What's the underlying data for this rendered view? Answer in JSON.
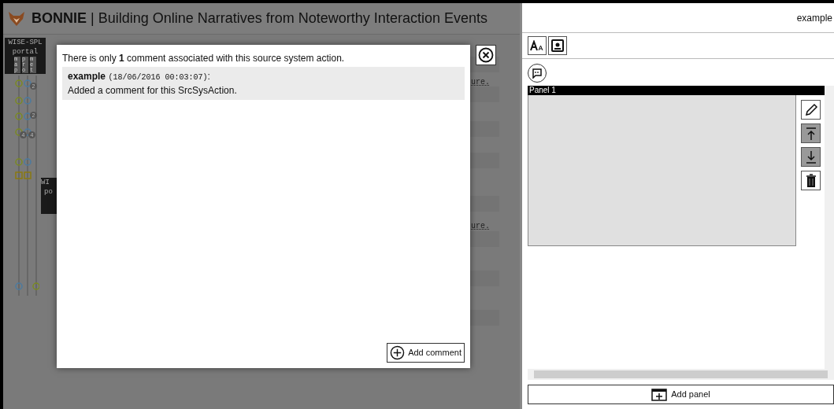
{
  "header": {
    "brand": "BONNIE",
    "separator": "|",
    "title": "Building Online Narratives from Noteworthy Interaction Events"
  },
  "timeline": {
    "lanes": [
      {
        "title": "WISE-SPL",
        "subtitle": "portal",
        "columns": [
          "map",
          "pro",
          "met"
        ]
      },
      {
        "title": "WI",
        "subtitle": "po"
      }
    ],
    "badges": [
      "2",
      "2",
      "4",
      "4"
    ],
    "notes": [
      "ure.",
      "ure."
    ]
  },
  "dialog": {
    "intro": "There is only **1** comment associated with this source system action.",
    "comments": [
      {
        "author": "example",
        "time": "(18/06/2016 00:03:07)",
        "suffix": ":",
        "text": "Added a comment for this SrcSysAction."
      }
    ],
    "add_button": "Add comment"
  },
  "side": {
    "user": "example",
    "panels": [
      {
        "title": "Panel 1",
        "selected": true
      }
    ],
    "add_panel": "Add panel"
  }
}
